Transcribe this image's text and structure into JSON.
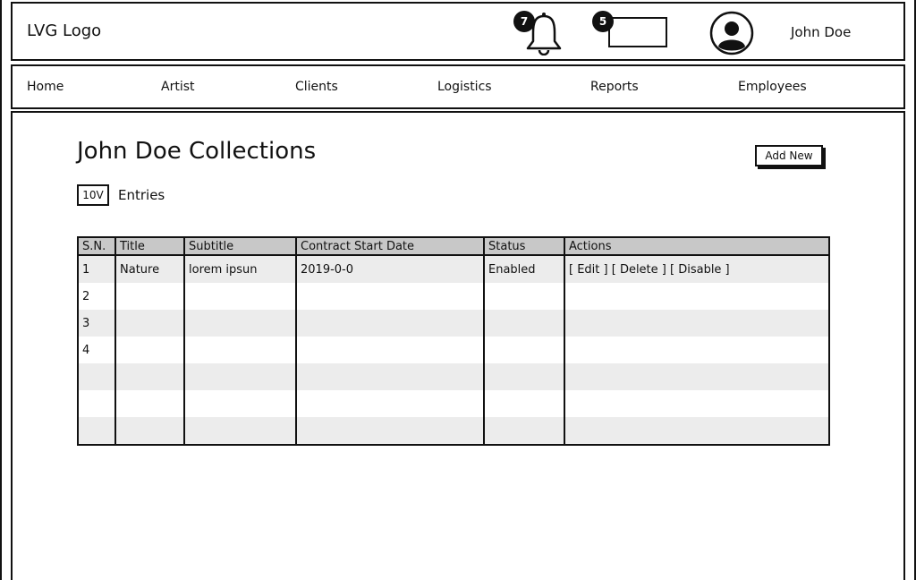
{
  "header": {
    "logo": "LVG Logo",
    "notifications_count": "7",
    "messages_count": "5",
    "user_name": "John Doe"
  },
  "nav": {
    "items": [
      "Home",
      "Artist",
      "Clients",
      "Logistics",
      "Reports",
      "Employees"
    ]
  },
  "main": {
    "title": "John Doe Collections",
    "add_button": "Add New",
    "entries_select": "10V",
    "entries_label": "Entries",
    "table": {
      "headers": [
        "S.N.",
        "Title",
        "Subtitle",
        "Contract Start Date",
        "Status",
        "Actions"
      ],
      "rows": [
        {
          "sn": "1",
          "title": "Nature",
          "subtitle": "lorem ipsun",
          "start": "2019-0-0",
          "status": "Enabled",
          "actions": {
            "edit": "[ Edit ]",
            "delete": "[ Delete ]",
            "disable": "[ Disable ]"
          }
        },
        {
          "sn": "2"
        },
        {
          "sn": "3"
        },
        {
          "sn": "4"
        },
        {
          "sn": ""
        },
        {
          "sn": ""
        },
        {
          "sn": ""
        }
      ]
    }
  }
}
